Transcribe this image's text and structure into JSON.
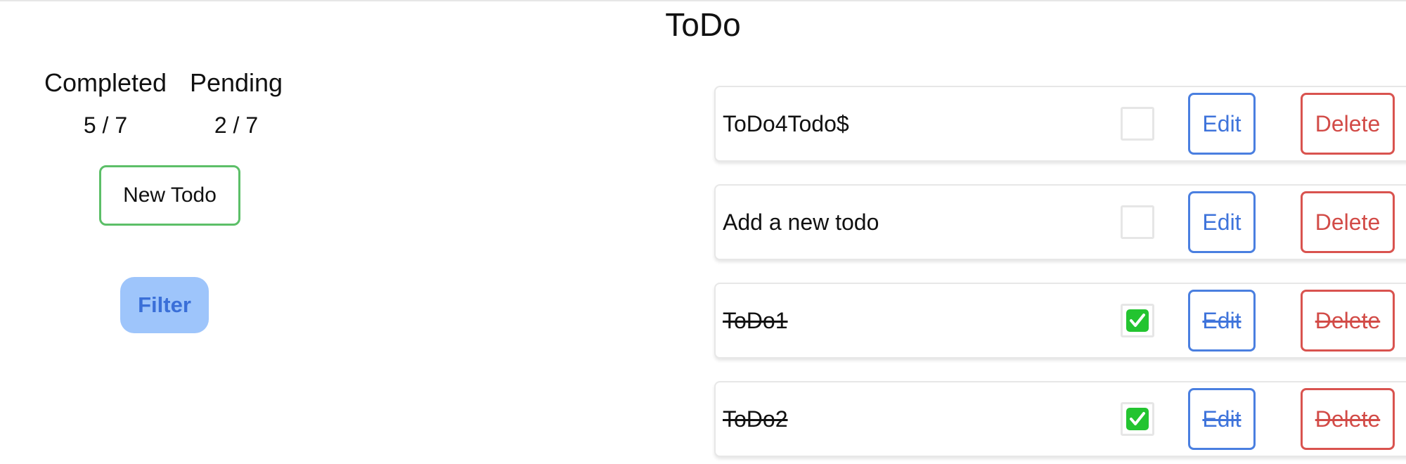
{
  "app": {
    "title": "ToDo"
  },
  "stats": {
    "completed_label": "Completed",
    "completed_value": "5 / 7",
    "pending_label": "Pending",
    "pending_value": "2 / 7"
  },
  "actions": {
    "new_todo_label": "New Todo",
    "filter_label": "Filter"
  },
  "todos": [
    {
      "text": "ToDo4Todo$",
      "completed": false,
      "edit_label": "Edit",
      "delete_label": "Delete"
    },
    {
      "text": "Add a new todo",
      "completed": false,
      "edit_label": "Edit",
      "delete_label": "Delete"
    },
    {
      "text": "ToDo1",
      "completed": true,
      "edit_label": "Edit",
      "delete_label": "Delete"
    },
    {
      "text": "ToDo2",
      "completed": true,
      "edit_label": "Edit",
      "delete_label": "Delete"
    }
  ],
  "colors": {
    "new_todo_border": "#5cbf68",
    "filter_bg": "#9ec5fb",
    "filter_text": "#3a6fd8",
    "edit": "#4a7fe0",
    "delete": "#d9534f",
    "check": "#23c430"
  },
  "icons": {
    "checkbox_checked": "check-icon"
  }
}
